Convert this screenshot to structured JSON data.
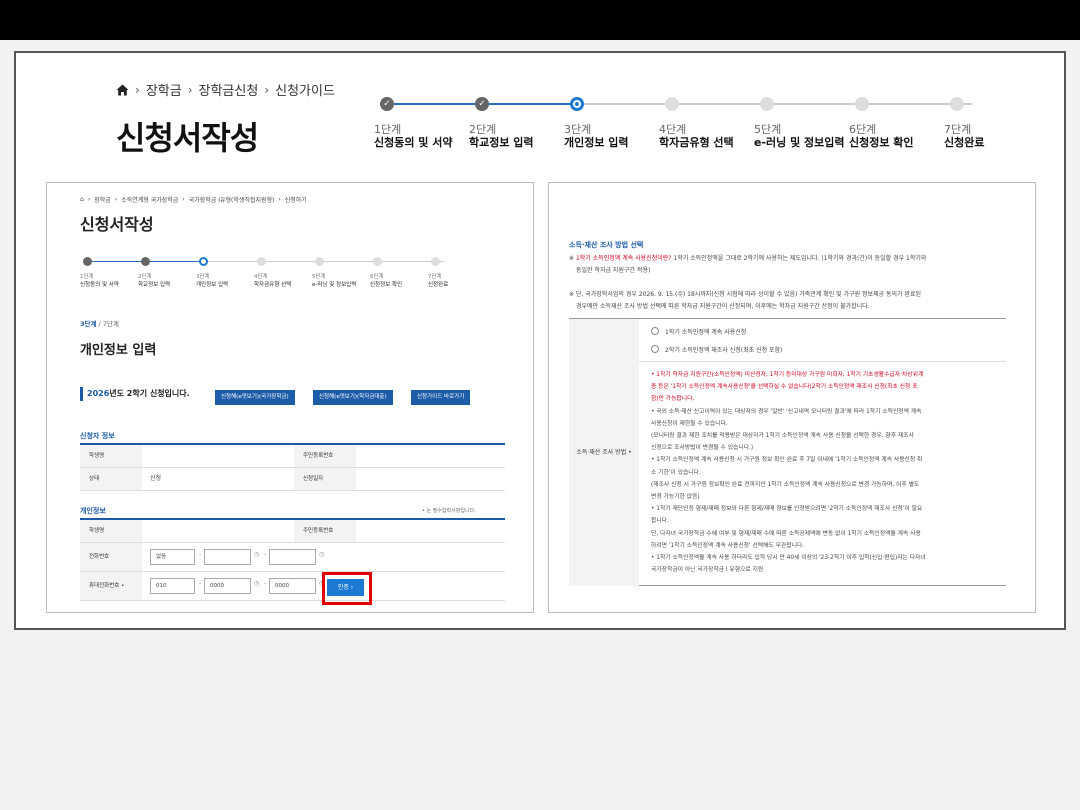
{
  "header": {
    "breadcrumb": [
      "장학금",
      "장학금신청",
      "신청가이드"
    ],
    "title": "신청서작성"
  },
  "steps": [
    {
      "num": "1단계",
      "name": "신청동의 및 서약",
      "status": "done"
    },
    {
      "num": "2단계",
      "name": "학교정보 입력",
      "status": "done"
    },
    {
      "num": "3단계",
      "name": "개인정보 입력",
      "status": "current"
    },
    {
      "num": "4단계",
      "name": "학자금유형 선택",
      "status": "todo"
    },
    {
      "num": "5단계",
      "name": "e-러닝 및 정보입력",
      "status": "todo"
    },
    {
      "num": "6단계",
      "name": "신청정보 확인",
      "status": "todo"
    },
    {
      "num": "7단계",
      "name": "신청완료",
      "status": "todo"
    }
  ],
  "left": {
    "breadcrumb": [
      "장학금",
      "소득연계형 국가장학금",
      "국가장학금 I유형(학생직접지원형)",
      "신청하기"
    ],
    "title": "신청서작성",
    "step_count_current": "3단계",
    "step_count_total": " / 7단계",
    "section_title": "개인정보 입력",
    "semester_year": "2026",
    "semester_text": "년도 2학기 신청입니다.",
    "buttons": [
      "신청해(e멋보기)(국가장학금)",
      "신청해(e멋보기)(학자금대출)",
      "신청가이드 바로가기"
    ],
    "applicant": {
      "title": "신청자 정보",
      "rows": [
        {
          "h1": "학생명",
          "v1": "",
          "h2": "주민등록번호",
          "v2": ""
        },
        {
          "h1": "상태",
          "v1": "신청",
          "h2": "신청일자",
          "v2": ""
        }
      ]
    },
    "personal": {
      "title": "개인정보",
      "required_note": "• 는 필수입력사항입니다.",
      "name_label": "학생명",
      "ssn_label": "주민등록번호",
      "phone_label": "전화번호",
      "phone_select": "없음",
      "mobile_label": "휴대전화번호 •",
      "mobile_select": "010",
      "mobile_mid": "0000",
      "mobile_last": "0000",
      "confirm_label": "인증 ›"
    }
  },
  "right": {
    "title": "소득·재산 조사 방법 선택",
    "note1a": "※ ",
    "note1_red": "1학기 소득인정액 계속 사용신청이란?",
    "note1b": " 1학기 소득인정액을 그대로 2학기에 사용하는 제도입니다. (1학기와 경과(간)이 동일할 경우 1학기와",
    "note1c": "동일한 학자금 지원구간 적용)",
    "note2a": "※ 단, 국가장학사업의 경우  2026. 9. 15.(수) 18시까지(신청 시점에 따라 상이할 수 있음) 가족관계 확인 및 가구원 정보제공 동의가 완료된",
    "note2b": "경우에만 소득재산 조사 방법 선택에 따른 학자금 지원구간이 산정되며, 이후에는 학자금 지원구간 산정이 불가합니다.",
    "row_label": "소득·재산 조사 방법 •",
    "option1": "1학기 소득인정액 계속 사용신청",
    "option2": "2학기 소득인정액 재조사 신청(최초 신청 포함)",
    "bullets": [
      {
        "text": "• 1학기 학자금 지원구간(소득인정액) 미산정자, 1학기 등미대상 가구원 미희자, 1학기 기초생활수급자·차상위계",
        "red": true
      },
      {
        "text": "  층 등은 '1학기 소득인정액 계속사용신청'을 선택하실 수 없습니다(2학기 소득인정액 재조사 신청(최초 신청 포",
        "red": true
      },
      {
        "text": "  함)만 가능합니다.",
        "red": true
      },
      {
        "text": "• 국외 소득·재산 신고이력이 있는 대상자의 경우 '일반' '신고내역 모니터링 결과'에 따라 1학기 소득인정액 계속",
        "red": false
      },
      {
        "text": "  사용신청이 제한될 수 있습니다.",
        "red": false
      },
      {
        "text": "  (모니터링 결과 제한 조치를 적용받은 대상자가 1학기 소득인정액 계속 사용 신청을 선택한 경우, 향후 재조사",
        "red": false
      },
      {
        "text": "  신청으로 조사방법이 변경될 수 있습니다.)",
        "red": false
      },
      {
        "text": "• 1학기 소득인정액 계속 사용신청 시 가구원 정보 확인 완료 후 7일 이내에 '1학기 소득인정액 계속 사용신청 취",
        "red": false
      },
      {
        "text": "  소 기한'이 있습니다.",
        "red": false
      },
      {
        "text": "  (재조사 신청 시 가구원 정보확인 완료 전까지만 1학기 소득인정액 계속 사용신청으로 변경 가능하며, 이후 별도",
        "red": false
      },
      {
        "text": "  변경 가능기한 없음)",
        "red": false
      },
      {
        "text": "• 1학기 재단인정 형제/재매 정보와 다른 형제/재매 정보를 인정받으려면 '2학기 소득인정액 재조사 신청'이 필요",
        "red": false
      },
      {
        "text": "  합니다.",
        "red": false
      },
      {
        "text": "  단, 다자녀 국가장학금 수혜 여부 및 형제/재매 수에 따른 소득공제액에 변동 없이 1학기 소득인정액을 계속 사용",
        "red": false
      },
      {
        "text": "  하려면 '1학기 소득인정액 계속 사용신청' 선택해도 무관합니다.",
        "red": false
      },
      {
        "text": "• 1학기 소득인정액을 계속 사용 하더라도 입학 당시 만 40세 이상의 '23-2학기 이후 입학(신입·편입)자는 다자녀",
        "red": false
      },
      {
        "text": "  국가장학금이 아닌 국가장학금 I 유형으로 지원",
        "red": false
      }
    ]
  }
}
